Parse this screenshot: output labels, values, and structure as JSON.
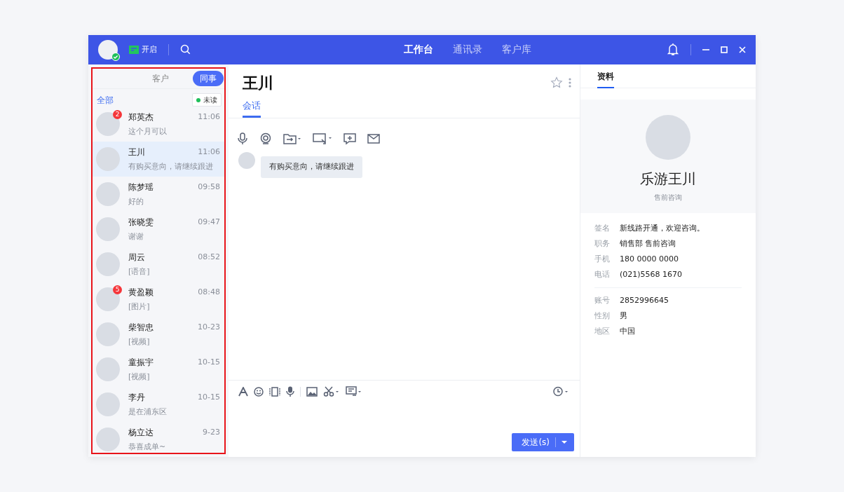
{
  "titlebar": {
    "online": true,
    "status_label": "开启",
    "nav": [
      {
        "label": "工作台",
        "selected": true
      },
      {
        "label": "通讯录",
        "selected": false
      },
      {
        "label": "客户库",
        "selected": false
      }
    ]
  },
  "contacts_panel": {
    "outlined": true,
    "tabs": [
      {
        "label": "客户",
        "selected": false
      },
      {
        "label": "同事",
        "selected": true
      }
    ],
    "filter_label": "全部",
    "unread_filter": "未读",
    "items": [
      {
        "name": "郑英杰",
        "preview": "这个月可以",
        "time": "11:06",
        "badge": "2",
        "selected": false
      },
      {
        "name": "王川",
        "preview": "有购买意向，请继续跟进",
        "time": "11:06",
        "selected": true
      },
      {
        "name": "陈梦瑶",
        "preview": "好的",
        "time": "09:58",
        "selected": false
      },
      {
        "name": "张晓雯",
        "preview": "谢谢",
        "time": "09:47",
        "selected": false
      },
      {
        "name": "周云",
        "preview": "[语音]",
        "time": "08:52",
        "selected": false
      },
      {
        "name": "黄盈颖",
        "preview": "[图片]",
        "time": "08:48",
        "badge": "5",
        "selected": false
      },
      {
        "name": "柴智忠",
        "preview": "[视频]",
        "time": "10-23",
        "selected": false
      },
      {
        "name": "童振宇",
        "preview": "[视频]",
        "time": "10-15",
        "selected": false
      },
      {
        "name": "李丹",
        "preview": "是在浦东区",
        "time": "10-15",
        "selected": false
      },
      {
        "name": "杨立达",
        "preview": "恭喜成单~",
        "time": "9-23",
        "selected": false
      }
    ]
  },
  "chat": {
    "title": "王川",
    "starred": false,
    "tabs": [
      {
        "label": "会话",
        "selected": true
      }
    ],
    "messages": [
      {
        "text": "有购买意向，请继续跟进"
      }
    ],
    "send_button": "发送(s)"
  },
  "profile": {
    "tab": "资料",
    "name": "乐游王川",
    "subtitle": "售前咨询",
    "field_groups": [
      [
        {
          "label": "签名",
          "value": "新线路开通，欢迎咨询。"
        },
        {
          "label": "职务",
          "value": "销售部 售前咨询"
        },
        {
          "label": "手机",
          "value": "180 0000 0000"
        },
        {
          "label": "电话",
          "value": "(021)5568 1670"
        }
      ],
      [
        {
          "label": "账号",
          "value": "2852996645"
        },
        {
          "label": "性别",
          "value": "男"
        },
        {
          "label": "地区",
          "value": "中国"
        }
      ]
    ]
  }
}
